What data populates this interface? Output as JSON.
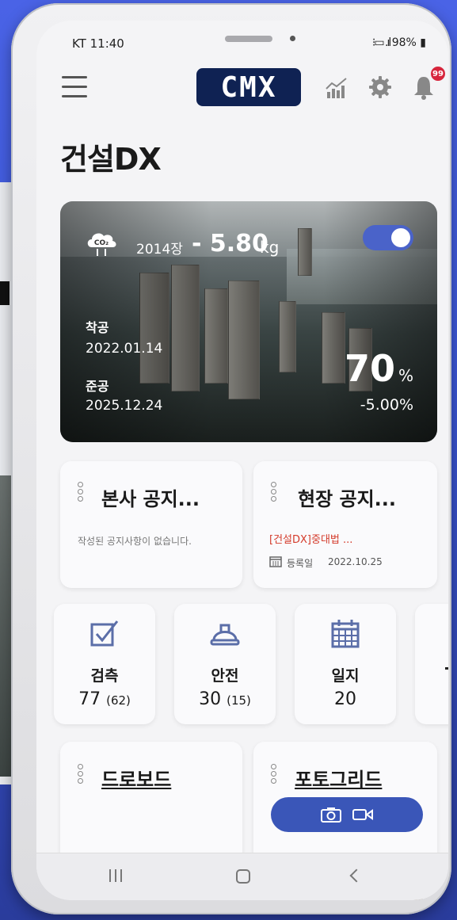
{
  "status": {
    "time": "KT 11:40",
    "system": "98%"
  },
  "header": {
    "logo": "CMX",
    "badge_count": "99"
  },
  "page": {
    "title": "건설DX"
  },
  "site": {
    "co2_count": "2014장",
    "co2_value": "- 5.80",
    "co2_unit": "kg",
    "toggle_on": true,
    "start_label": "착공",
    "start_date": "2022.01.14",
    "end_label": "준공",
    "end_date": "2025.12.24",
    "progress": "70",
    "progress_unit": "%",
    "change": "-5.00%"
  },
  "notices": [
    {
      "title": "본사 공지...",
      "empty_text": "작성된 공지사항이 없습니다."
    },
    {
      "title": "현장 공지...",
      "link_text": "[건설DX]중대법 ...",
      "reg_label": "등록일",
      "reg_date": "2022.10.25"
    }
  ],
  "stats": [
    {
      "icon": "check-icon",
      "label": "검측",
      "value": "77",
      "sub": "(62)"
    },
    {
      "icon": "helmet-icon",
      "label": "안전",
      "value": "30",
      "sub": "(15)"
    },
    {
      "icon": "calendar-icon",
      "label": "일지",
      "value": "20",
      "sub": ""
    }
  ],
  "sections": {
    "drone": "드로보드",
    "photo": "포토그리드"
  },
  "colors": {
    "primary": "#3a56b8",
    "logo_bg": "#0f2253",
    "alert": "#d7263d",
    "link_red": "#d43b2b"
  }
}
